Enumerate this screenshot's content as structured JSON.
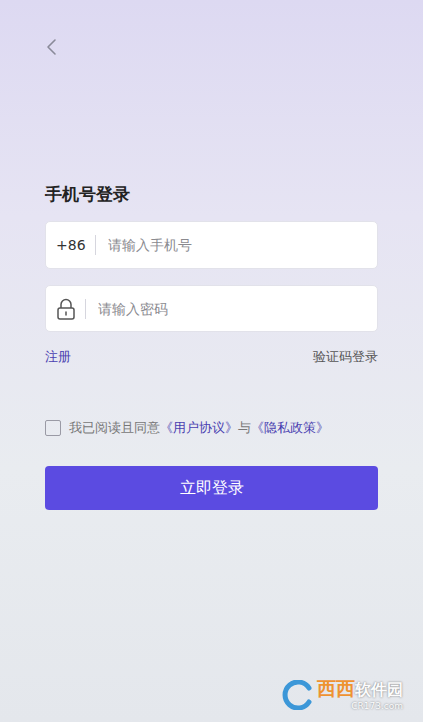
{
  "title": "手机号登录",
  "phone": {
    "prefix": "+86",
    "placeholder": "请输入手机号"
  },
  "password": {
    "placeholder": "请输入密码"
  },
  "links": {
    "register": "注册",
    "sms_login": "验证码登录"
  },
  "agreement": {
    "checked": false,
    "parts": [
      {
        "text": "我已阅读且同意",
        "kind": "plain"
      },
      {
        "text": "《用户协议》",
        "kind": "link"
      },
      {
        "text": "与",
        "kind": "plain"
      },
      {
        "text": "《隐私政策》",
        "kind": "link"
      }
    ]
  },
  "submit": "立即登录",
  "watermark": {
    "brand": "西西",
    "name": "软件园",
    "site": "CR173.com"
  }
}
